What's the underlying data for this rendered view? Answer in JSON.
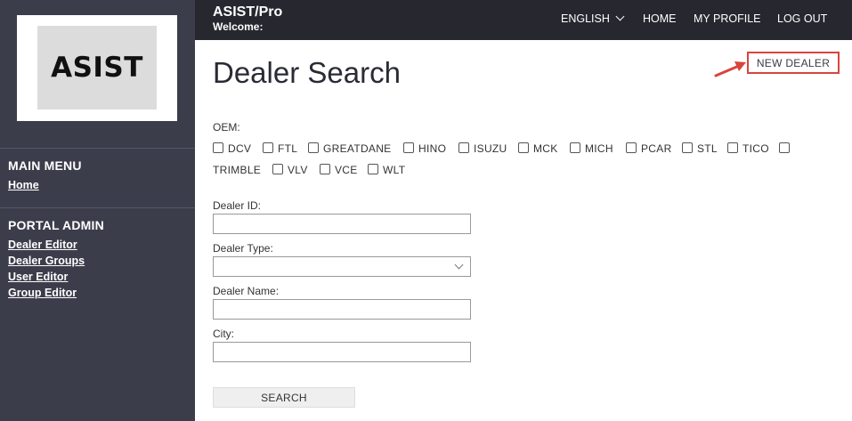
{
  "sidebar": {
    "logo_text": "ASIST",
    "main_menu": {
      "heading": "MAIN MENU",
      "links": [
        "Home"
      ]
    },
    "portal_admin": {
      "heading": "PORTAL ADMIN",
      "links": [
        "Dealer Editor",
        "Dealer Groups",
        "User Editor",
        "Group Editor"
      ]
    }
  },
  "header": {
    "brand": "ASIST/Pro",
    "welcome": "Welcome:",
    "language": "ENGLISH",
    "nav": [
      "HOME",
      "MY PROFILE",
      "LOG OUT"
    ]
  },
  "main": {
    "title": "Dealer Search",
    "new_dealer_label": "NEW DEALER",
    "oem_label": "OEM:",
    "oems": [
      "DCV",
      "FTL",
      "GREATDANE",
      "HINO",
      "ISUZU",
      "MCK",
      "MICH",
      "PCAR",
      "STL",
      "TICO",
      "TRIMBLE",
      "VLV",
      "VCE",
      "WLT"
    ],
    "fields": {
      "dealer_id": {
        "label": "Dealer ID:",
        "value": ""
      },
      "dealer_type": {
        "label": "Dealer Type:",
        "value": ""
      },
      "dealer_name": {
        "label": "Dealer Name:",
        "value": ""
      },
      "city": {
        "label": "City:",
        "value": ""
      }
    },
    "search_label": "SEARCH"
  },
  "colors": {
    "sidebar_bg": "#3c3d4b",
    "topbar_bg": "#26272f",
    "highlight": "#d9443c"
  }
}
